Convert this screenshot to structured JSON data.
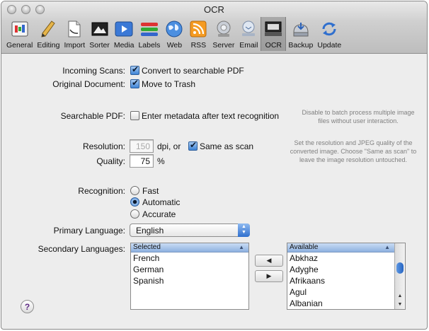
{
  "window": {
    "title": "OCR"
  },
  "toolbar": {
    "items": [
      {
        "label": "General",
        "icon": "general-icon"
      },
      {
        "label": "Editing",
        "icon": "pencil-icon"
      },
      {
        "label": "Import",
        "icon": "import-icon"
      },
      {
        "label": "Sorter",
        "icon": "sorter-icon"
      },
      {
        "label": "Media",
        "icon": "media-icon"
      },
      {
        "label": "Labels",
        "icon": "labels-icon"
      },
      {
        "label": "Web",
        "icon": "globe-icon"
      },
      {
        "label": "RSS",
        "icon": "rss-icon"
      },
      {
        "label": "Server",
        "icon": "server-icon"
      },
      {
        "label": "Email",
        "icon": "email-icon"
      },
      {
        "label": "OCR",
        "icon": "ocr-icon"
      },
      {
        "label": "Backup",
        "icon": "backup-icon"
      },
      {
        "label": "Update",
        "icon": "update-icon"
      }
    ],
    "selected": "OCR"
  },
  "incoming_scans": {
    "label": "Incoming Scans:",
    "option": "Convert to searchable PDF",
    "checked": true
  },
  "original_document": {
    "label": "Original Document:",
    "option": "Move to Trash",
    "checked": true
  },
  "searchable_pdf": {
    "label": "Searchable PDF:",
    "option": "Enter metadata after text recognition",
    "checked": false,
    "hint": "Disable to batch process multiple image files without user interaction."
  },
  "resolution": {
    "label": "Resolution:",
    "value": "150",
    "unit": "dpi, or",
    "same_as_scan": "Same as scan",
    "same_as_scan_checked": true,
    "hint": "Set the resolution and JPEG quality of the converted image. Choose \"Same as scan\" to leave the image resolution untouched."
  },
  "quality": {
    "label": "Quality:",
    "value": "75",
    "unit": "%"
  },
  "recognition": {
    "label": "Recognition:",
    "options": [
      "Fast",
      "Automatic",
      "Accurate"
    ],
    "selected": "Automatic"
  },
  "primary_language": {
    "label": "Primary Language:",
    "value": "English"
  },
  "secondary_languages": {
    "label": "Secondary Languages:",
    "selected_header": "Selected",
    "selected_items": [
      "French",
      "German",
      "Spanish"
    ],
    "available_header": "Available",
    "available_items": [
      "Abkhaz",
      "Adyghe",
      "Afrikaans",
      "Agul",
      "Albanian"
    ],
    "move_left_label": "◀",
    "move_right_label": "▶"
  },
  "help": {
    "label": "?"
  }
}
